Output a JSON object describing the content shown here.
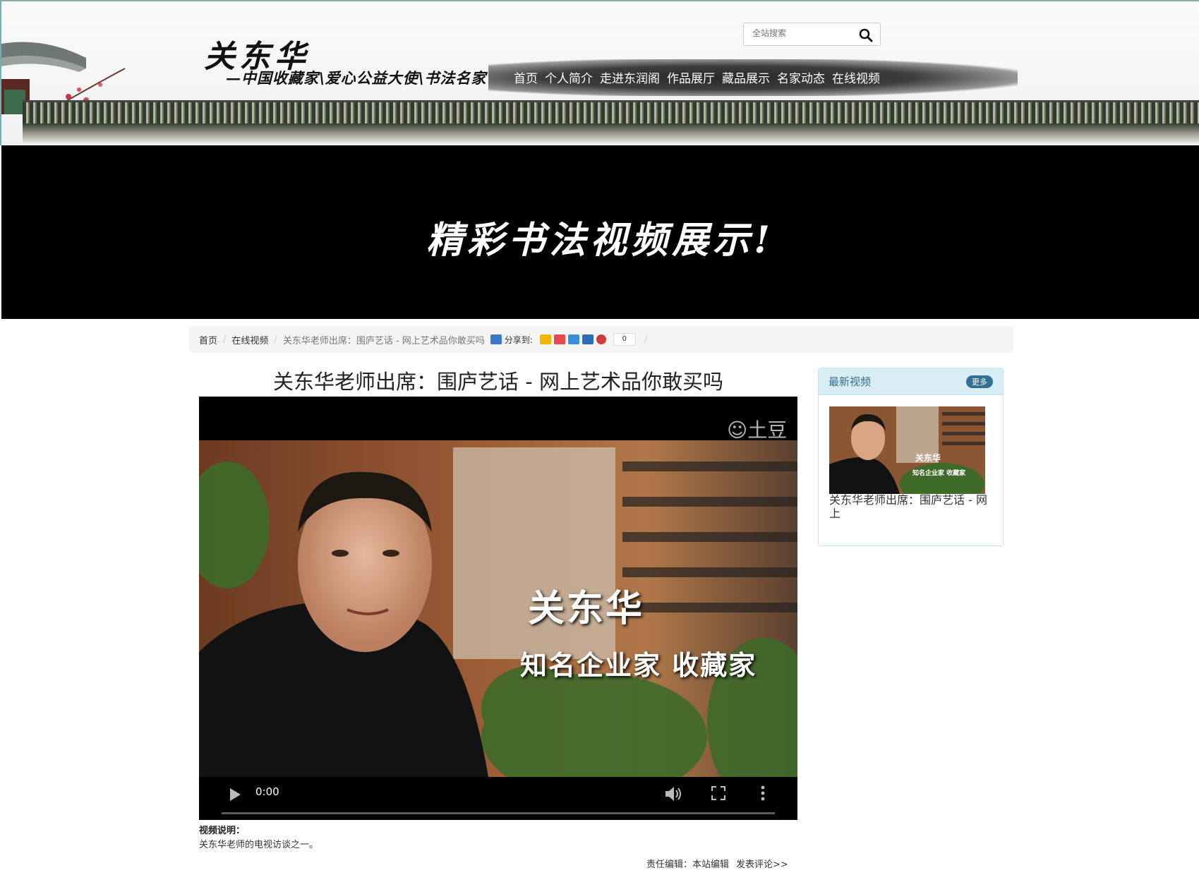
{
  "header": {
    "brand": "关东华",
    "tagline": "—中国收藏家\\爱心公益大使\\书法名家",
    "nav": [
      "首页",
      "个人简介",
      "走进东润阁",
      "作品展厅",
      "藏品展示",
      "名家动态",
      "在线视频"
    ],
    "search": {
      "placeholder": "全站搜索",
      "icon": "search-icon"
    }
  },
  "banner": {
    "text": "精彩书法视频展示!"
  },
  "breadcrumb": {
    "items": [
      "首页",
      "在线视频"
    ],
    "current": "关东华老师出席：围庐艺话 - 网上艺术品你敢买吗",
    "share_label": "分享到:",
    "share_count": "0"
  },
  "main": {
    "title": "关东华老师出席：围庐艺话 - 网上艺术品你敢买吗",
    "video": {
      "overlay_name": "关东华",
      "overlay_role": "知名企业家 收藏家",
      "watermark": "土豆",
      "current_time": "0:00",
      "progress": 0
    },
    "description_label": "视频说明：",
    "description": "关东华老师的电视访谈之一。",
    "editor": "责任编辑：本站编辑",
    "comment_link": "发表评论>>"
  },
  "sidebar": {
    "title": "最新视频",
    "more": "更多",
    "items": [
      {
        "caption": "关东华老师出席：围庐艺话 - 网上",
        "thumb_name": "关东华",
        "thumb_role": "知名企业家 收藏家"
      }
    ]
  },
  "colors": {
    "banner_bg": "#000000",
    "panel_head_bg": "#d9edf7",
    "panel_title": "#31708f",
    "breadcrumb_bg": "#f5f5f5"
  }
}
